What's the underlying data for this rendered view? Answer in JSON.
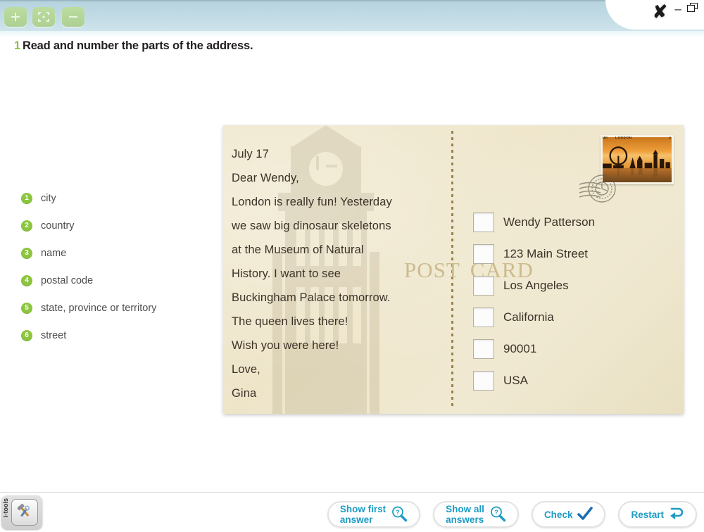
{
  "toolbar": {
    "zoom_in": "zoom-in-icon",
    "zoom_fit": "fit-screen-icon",
    "zoom_out": "zoom-out-icon"
  },
  "window": {
    "close": "✘",
    "minimize": "–",
    "restore": "restore-window-icon"
  },
  "exercise": {
    "number": "1",
    "instruction": "Read and number the parts of the address."
  },
  "key_list": [
    {
      "number": "1",
      "label": "city"
    },
    {
      "number": "2",
      "label": "country"
    },
    {
      "number": "3",
      "label": "name"
    },
    {
      "number": "4",
      "label": "postal code"
    },
    {
      "number": "5",
      "label": "state, province or territory"
    },
    {
      "number": "6",
      "label": "street"
    }
  ],
  "postcard": {
    "title_left": "POST",
    "title_right": "CARD",
    "message_lines": [
      "July 17",
      "Dear Wendy,",
      "London is really fun! Yesterday",
      "we saw big dinosaur skeletons",
      "at the Museum of Natural",
      "History. I want to see",
      "Buckingham Palace tomorrow.",
      "The queen lives there!",
      "Wish you were here!",
      "Love,",
      "Gina"
    ],
    "stamp": {
      "country": "UK",
      "city": "LONDON",
      "value": "£"
    },
    "address_lines": [
      {
        "value": "",
        "text": "Wendy Patterson"
      },
      {
        "value": "",
        "text": "123 Main Street"
      },
      {
        "value": "",
        "text": "Los Angeles"
      },
      {
        "value": "",
        "text": "California"
      },
      {
        "value": "",
        "text": "90001"
      },
      {
        "value": "",
        "text": "USA"
      }
    ]
  },
  "footer": {
    "itools_label": "i-tools",
    "buttons": {
      "show_first_line1": "Show first",
      "show_first_line2": "answer",
      "show_all_line1": "Show all",
      "show_all_line2": "answers",
      "check": "Check",
      "restart": "Restart"
    }
  },
  "colors": {
    "accent_green": "#8cc63f",
    "accent_teal": "#1d9cc4",
    "header_blue": "#c2dbe5",
    "postcard_cream": "#eee5c9"
  }
}
